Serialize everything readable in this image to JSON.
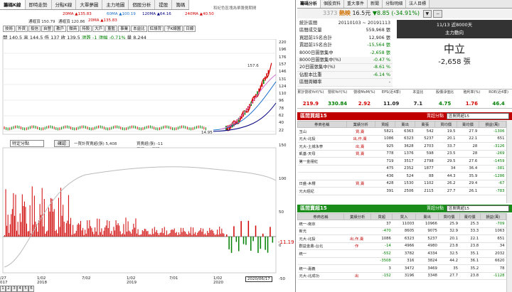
{
  "chart_tabs": [
    "籌碼K線",
    "即時走勢",
    "分點K線",
    "大單夢圖",
    "主力地圖",
    "個股分析",
    "提股",
    "籌碼"
  ],
  "chart_marquee": "和紀色區塊為單籌覺期間",
  "ma_legend": {
    "ma20": "20MA ▲135.83",
    "ma60": "60MA ▲100.19",
    "ma120": "120MA ▲64.16",
    "ma240": "240MA ▲40.50",
    "tongpan": "通缠頂 150.79",
    "tongpan2": "通缠頂 120.86",
    "ma20b": "20MA ▲135.83"
  },
  "toolbar": [
    "技術",
    "外資",
    "投信",
    "自營",
    "散戶",
    "微商",
    "持股",
    "大戶",
    "董監",
    "事業",
    "本益比",
    "紅綠背",
    "子K線圖",
    "日線"
  ],
  "ohlc": {
    "open": "開 140.5",
    "high": "高 144.5",
    "low": "低 137",
    "close": "收 139.5",
    "change": "漲跌 -1",
    "pct": "漲幅 -0.71%",
    "volume": "量 8,244"
  },
  "price_axis": [
    "220",
    "196",
    "176",
    "157",
    "146",
    "131",
    "124",
    "110",
    "96",
    "78",
    "62",
    "40",
    "22"
  ],
  "price_annot": {
    "peak": "157.6",
    "trough": "14.95"
  },
  "lower": {
    "panel_label": "特定分點",
    "panel_btn": "確認",
    "broker_code": "8840",
    "broker_name": "玉山",
    "legend1": "一買計買賣超(張) 5,408",
    "legend2": "買賣超(張) -11",
    "legend3": "買張 21 賣張 32",
    "current": "-11.19",
    "axis": [
      "150",
      "100",
      "50",
      "0",
      "-50"
    ]
  },
  "date_axis": [
    {
      "l1": "/27",
      "l2": "017"
    },
    {
      "l1": "1/02",
      "l2": "2018"
    },
    {
      "l1": "7/02",
      "l2": ""
    },
    {
      "l1": "1/02",
      "l2": "2019"
    },
    {
      "l1": "7/01",
      "l2": ""
    },
    {
      "l1": "1/02",
      "l2": "2020"
    },
    {
      "l1": "2020/06/17",
      "l2": ""
    }
  ],
  "pages": [
    "1",
    "2",
    "3",
    "4",
    "5",
    "6"
  ],
  "right_tabs": [
    "籌碼分析",
    "個股資料",
    "重大事件",
    "新聞",
    "分點明細",
    "法人目標"
  ],
  "quote": {
    "code": "3373",
    "name": "熱映",
    "price": "16.5元",
    "change": "▼8.85 (-34.91%)",
    "btn1": "▼",
    "btn2": "−"
  },
  "stats": [
    {
      "k": "統計區間",
      "v": "20110103 ~ 20191113"
    },
    {
      "k": "區間成交量",
      "v": "559,968 張"
    },
    {
      "k": "買超前15名合計",
      "v": "12,906 張"
    },
    {
      "k": "賣超前15名合計",
      "v": "-15,564 張"
    },
    {
      "k": "8000日圖張集中",
      "v": "-2,658 張"
    },
    {
      "k": "8000日圖張集中(%)",
      "v": "-0.47 %"
    },
    {
      "k": "20日圖張集中(%)",
      "v": "-8.61 %"
    },
    {
      "k": "佔股本比重",
      "v": "-6.14 %"
    },
    {
      "k": "區間周轉率",
      "v": "-"
    }
  ],
  "summary": {
    "date": "11/13 近8000天",
    "label": "主力動向",
    "state": "中立",
    "amount": "-2,658 張"
  },
  "metrics": {
    "headers": [
      "累計營收YoY(%)",
      "營收YoY(%)",
      "營收MoM(%)",
      "EPS(近4季)",
      "本益比",
      "股價淨值比",
      "殖利率(%)",
      "ROE(近4季)"
    ],
    "values": [
      "219.9",
      "330.84",
      "2.92",
      "11.09",
      "7.1",
      "4.75",
      "1.76",
      "46.4"
    ]
  },
  "buy_section": {
    "title": "區間買超15",
    "label": "賣超分點",
    "select": "區間買超15"
  },
  "buy_headers": [
    "券商名稱",
    "業績分析",
    "買超",
    "賣出",
    "賣張",
    "買均價",
    "賣均價",
    "損益(萬)"
  ],
  "buy_rows": [
    [
      "玉山",
      "買,賣",
      "5821",
      "6363",
      "542",
      "19.5",
      "27.9",
      "-1306"
    ],
    [
      "元大-北投",
      "出,作,賣",
      "1086",
      "6323",
      "5237",
      "20.1",
      "22.1",
      "651"
    ],
    [
      "元大-土城永寧",
      "出,賣",
      "925",
      "3628",
      "2703",
      "33.7",
      "28",
      "-3126"
    ],
    [
      "凱基-天母",
      "買,賣",
      "778",
      "1376",
      "598",
      "23.5",
      "28",
      "-269"
    ],
    [
      "第一金證紅",
      "",
      "719",
      "3517",
      "2798",
      "29.5",
      "27.6",
      "-1459"
    ],
    [
      "",
      "",
      "475",
      "2352",
      "1877",
      "34",
      "36.4",
      "-381"
    ],
    [
      "",
      "",
      "436",
      "524",
      "88",
      "44.3",
      "35.9",
      "-1286"
    ],
    [
      "日盛-木柵",
      "買,賣",
      "428",
      "1530",
      "1102",
      "26.2",
      "29.4",
      "-67"
    ],
    [
      "元大經紀",
      "",
      "391",
      "2506",
      "2115",
      "27.7",
      "26.1",
      "-783"
    ]
  ],
  "sell_section": {
    "title": "區間賣超15",
    "label": "賣超分點",
    "select": "區間賣超15"
  },
  "sell_headers": [
    "券商名稱",
    "業績分析",
    "買超",
    "買入",
    "賣出",
    "買均價",
    "賣均價",
    "損益(萬)"
  ],
  "sell_rows": [
    [
      "統一-南京",
      "",
      "37",
      "11003",
      "10966",
      "25.9",
      "25.3",
      "-709"
    ],
    [
      "新光",
      "",
      "-470",
      "8605",
      "9075",
      "32.9",
      "33.3",
      "1063"
    ],
    [
      "元大-北投",
      "出,作,賣",
      "1086",
      "6323",
      "5237",
      "20.1",
      "22.1",
      "651"
    ],
    [
      "群益金鼎-台北",
      "作",
      "-14",
      "4966",
      "4980",
      "23.8",
      "23.8",
      "34"
    ],
    [
      "統一",
      "",
      "-552",
      "3782",
      "4334",
      "32.5",
      "35.1",
      "2032"
    ],
    [
      "",
      "",
      "-3508",
      "316",
      "3824",
      "44.2",
      "36.1",
      "6620"
    ],
    [
      "統一-嘉義",
      "",
      "3",
      "3472",
      "3469",
      "35",
      "35.2",
      "78"
    ],
    [
      "元大-北成功",
      "出",
      "-152",
      "3196",
      "3348",
      "27.7",
      "23.8",
      "-1128"
    ]
  ]
}
